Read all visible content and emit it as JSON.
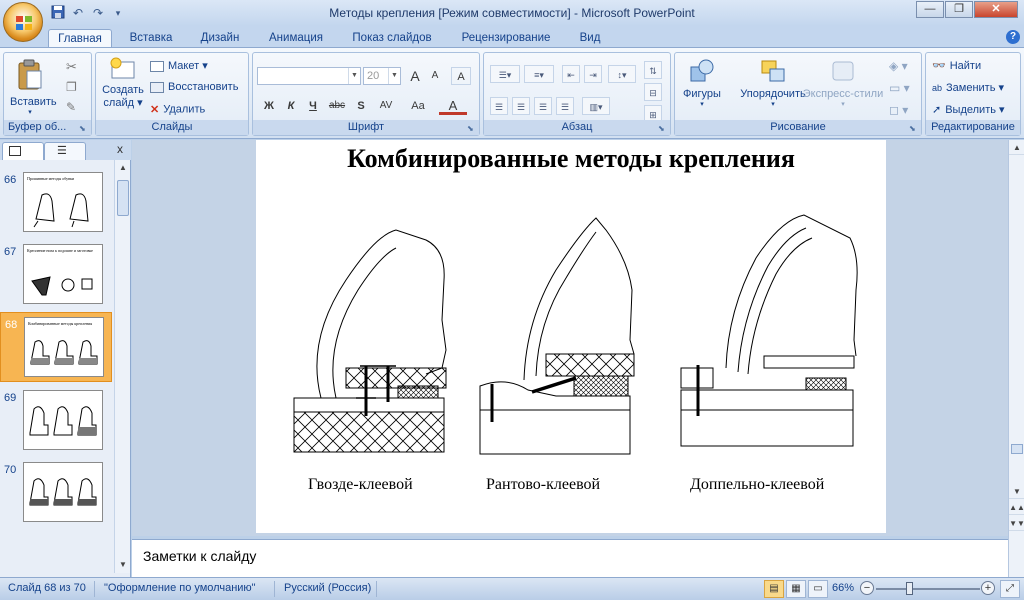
{
  "window": {
    "title": "Методы крепления [Режим совместимости] - Microsoft PowerPoint"
  },
  "ribbon_tabs": [
    "Главная",
    "Вставка",
    "Дизайн",
    "Анимация",
    "Показ слайдов",
    "Рецензирование",
    "Вид"
  ],
  "clipboard": {
    "paste": "Вставить",
    "group": "Буфер об..."
  },
  "slides_group": {
    "new_slide_1": "Создать",
    "new_slide_2": "слайд",
    "layout": "Макет",
    "reset": "Восстановить",
    "delete": "Удалить",
    "group": "Слайды"
  },
  "font_group": {
    "font_name": "",
    "font_size": "20",
    "group": "Шрифт",
    "bold": "Ж",
    "italic": "К",
    "underline": "Ч",
    "strike": "abc",
    "shadow": "S",
    "spacing": "AV",
    "case": "Aa",
    "grow": "A",
    "shrink": "A",
    "clear": "A",
    "color": "A"
  },
  "paragraph_group": {
    "group": "Абзац"
  },
  "drawing_group": {
    "shapes": "Фигуры",
    "arrange": "Упорядочить",
    "quick_styles": "Экспресс-стили",
    "group": "Рисование"
  },
  "editing_group": {
    "find": "Найти",
    "replace": "Заменить",
    "select": "Выделить",
    "group": "Редактирование"
  },
  "thumbnails": [
    {
      "num": "66",
      "title": "Прошивные методы обувки",
      "selected": false
    },
    {
      "num": "67",
      "title": "Крепление низа к подошве и заготовке",
      "selected": false
    },
    {
      "num": "68",
      "title": "Комбинированные методы крепления",
      "selected": true
    },
    {
      "num": "69",
      "title": "",
      "selected": false
    },
    {
      "num": "70",
      "title": "",
      "selected": false
    }
  ],
  "slide": {
    "title": "Комбинированные методы крепления",
    "captions": [
      "Гвозде-клеевой",
      "Рантово-клеевой",
      "Доппельно-клеевой"
    ]
  },
  "notes": {
    "placeholder": "Заметки к слайду"
  },
  "status": {
    "slide": "Слайд 68 из 70",
    "theme": "\"Оформление по умолчанию\"",
    "language": "Русский (Россия)",
    "zoom": "66%"
  }
}
